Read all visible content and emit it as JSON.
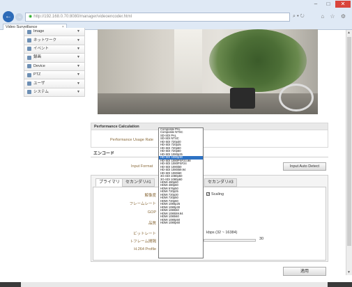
{
  "browser": {
    "address": "http://192.168.0.70:8080/manager/videoencoder.html",
    "tab_title": "Video Surveillance",
    "tab_close": "×",
    "min": "–",
    "max": "□",
    "close": "✕"
  },
  "sidebar": {
    "items": [
      {
        "label": "Image",
        "icon": "image-icon"
      },
      {
        "label": "ネットワーク",
        "icon": "network-icon"
      },
      {
        "label": "イベント",
        "icon": "event-icon"
      },
      {
        "label": "録画",
        "icon": "record-icon"
      },
      {
        "label": "Device",
        "icon": "device-icon"
      },
      {
        "label": "PTZ",
        "icon": "ptz-icon"
      },
      {
        "label": "ユーザ",
        "icon": "user-icon"
      },
      {
        "label": "システム",
        "icon": "system-icon"
      }
    ],
    "chevron": "▼"
  },
  "performance": {
    "title": "Performance Calculation",
    "usage_label": "Performance Usage Rate"
  },
  "encode": {
    "title": "エンコード",
    "input_format_label": "Input Format",
    "auto_detect": "Input Auto Detect",
    "tabs": [
      "プライマリ",
      "セカンダリ#1",
      "セカンダリ#3"
    ],
    "labels": {
      "resolution": "解像度",
      "framerate": "フレームレート",
      "gop": "GOP",
      "quality": "品質",
      "bitrate": "ビットレート",
      "iframe": "I-フレーム間隔",
      "h264": "H.264 Profile"
    },
    "scaling": "Scaling",
    "bitrate_unit": "kbps (32 ~ 16384)",
    "slider_value": "30",
    "save": "適用"
  },
  "dropdown_options": [
    "Composite PAL",
    "Composite NTSC",
    "SD-SDI PAL",
    "SD-SDI NTSC",
    "HD-SDI 720p30",
    "HD-SDI 720p25",
    "HD-SDI 720p50",
    "HD-SDI 720p60",
    "HD-SDI 1080p25",
    "HD-SDI 1080p30",
    "HD-SDI 1080PSF23.98",
    "HD-SDI 1080PSF24",
    "HD-SDI 1080i50",
    "HD-SDI 1080i59.94",
    "HD-SDI 1080i60",
    "3G-SDI 1080p50",
    "3G-SDI 1080p60",
    "HDMI 480p60",
    "HDMI 480p60",
    "HDMI 576p50",
    "HDMI 720p25",
    "HDMI 720p30",
    "HDMI 720p50",
    "HDMI 720p60",
    "HDMI 1080p25",
    "HDMI 1080p30",
    "HDMI 1080i50",
    "HDMI 1080i59.94",
    "HDMI 1080i60",
    "HDMI 1080p50",
    "HDMI 1080p60"
  ],
  "dropdown_selected_index": 9
}
